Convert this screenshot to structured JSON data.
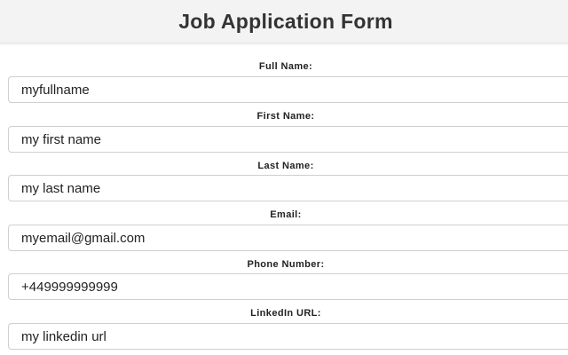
{
  "header": {
    "title": "Job Application Form"
  },
  "fields": [
    {
      "label": "Full Name:",
      "value": "myfullname"
    },
    {
      "label": "First Name:",
      "value": "my first name"
    },
    {
      "label": "Last Name:",
      "value": "my last name"
    },
    {
      "label": "Email:",
      "value": "myemail@gmail.com"
    },
    {
      "label": "Phone Number:",
      "value": "+449999999999"
    },
    {
      "label": "LinkedIn URL:",
      "value": "my linkedin url"
    }
  ]
}
